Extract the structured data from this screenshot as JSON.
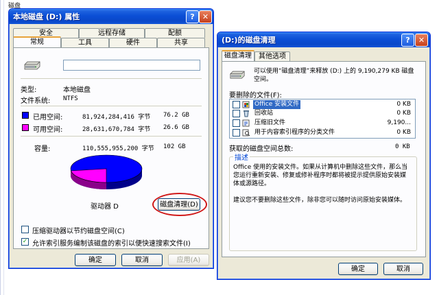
{
  "background": {
    "text": "磁盘"
  },
  "props": {
    "title": "本地磁盘 (D:) 属性",
    "help_glyph": "?",
    "close_glyph": "✕",
    "tabs_top": [
      "安全",
      "远程存储",
      "配额"
    ],
    "tabs_bottom": [
      "常规",
      "工具",
      "硬件",
      "共享"
    ],
    "type_label": "类型:",
    "type_value": "本地磁盘",
    "fs_label": "文件系统:",
    "fs_value": "NTFS",
    "used_label": "已用空间:",
    "used_bytes": "81,924,284,416 字节",
    "used_gb": "76.2 GB",
    "free_label": "可用空间:",
    "free_bytes": "28,631,670,784 字节",
    "free_gb": "26.6 GB",
    "cap_label": "容量:",
    "cap_bytes": "110,555,955,200 字节",
    "cap_gb": "102 GB",
    "drive_label": "驱动器 D",
    "cleanup_button": "磁盘清理(D)",
    "compress_label": "压缩驱动器以节约磁盘空间(C)",
    "index_label": "允许索引服务编制该磁盘的索引以便快速搜索文件(I)",
    "ok": "确定",
    "cancel": "取消",
    "apply": "应用(A)",
    "colors": {
      "used": "#0000ff",
      "free": "#ff00ff"
    }
  },
  "cleanup": {
    "title": "(D:)的磁盘清理",
    "help_glyph": "?",
    "close_glyph": "✕",
    "tabs": [
      "磁盘清理",
      "其他选项"
    ],
    "intro": "可以使用“磁盘清理”来释放 (D:) 上的 9,190,279 KB 磁盘空间。",
    "delete_label": "要删除的文件(F):",
    "files": [
      {
        "name": "Office 安装文件",
        "size": "0 KB",
        "checked": false,
        "selected": true
      },
      {
        "name": "回收站",
        "size": "0 KB",
        "checked": false,
        "selected": false
      },
      {
        "name": "压缩旧文件",
        "size": "9,190...",
        "checked": false,
        "selected": false
      },
      {
        "name": "用于内容索引程序的分类文件",
        "size": "0 KB",
        "checked": false,
        "selected": false
      }
    ],
    "total_label": "获取的磁盘空间总数:",
    "total_value": "0 KB",
    "desc_title": "描述",
    "desc_text": "Office 使用的安装文件。如果从计算机中删除这些文件，那么当您运行重新安装、修复或修补程序时都将被提示提供原始安装媒体或源路径。",
    "desc_text2": "建议您不要删除这些文件，除非您可以随时访问原始安装媒体。",
    "ok": "确定",
    "cancel": "取消"
  }
}
